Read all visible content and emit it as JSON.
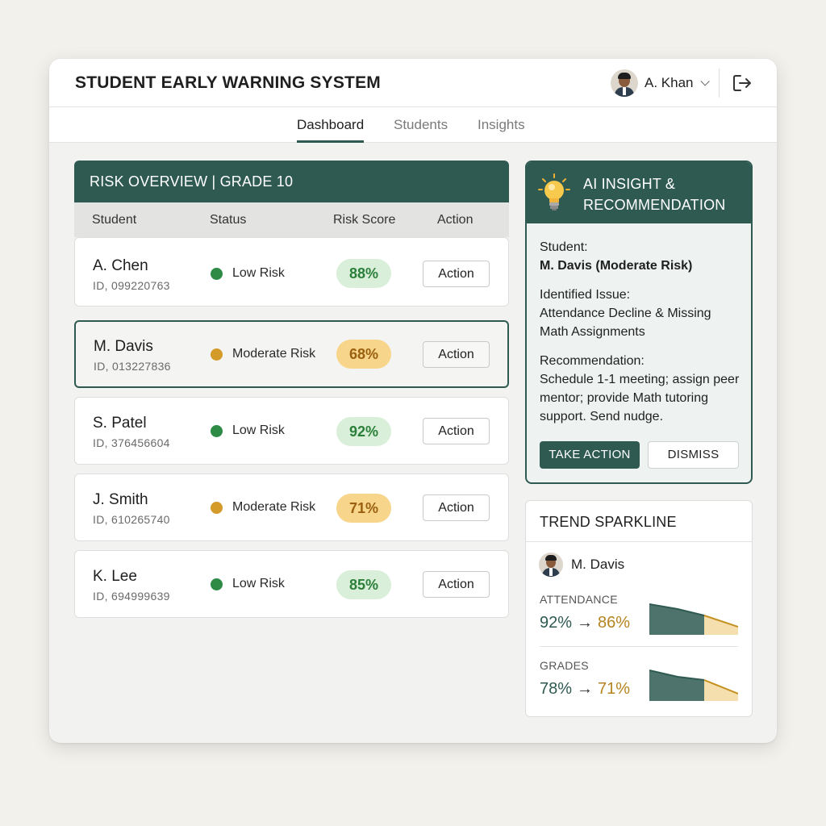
{
  "app": {
    "title": "STUDENT EARLY WARNING SYSTEM",
    "user_name": "A. Khan",
    "icons": {
      "user": "avatar-icon",
      "dropdown": "chevron-down-icon",
      "logout": "logout-icon"
    }
  },
  "tabs": [
    {
      "label": "Dashboard",
      "active": true
    },
    {
      "label": "Students",
      "active": false
    },
    {
      "label": "Insights",
      "active": false
    }
  ],
  "risk_overview": {
    "title": "RISK OVERVIEW | GRADE 10",
    "columns": [
      "Student",
      "Status",
      "Risk Score",
      "Action"
    ],
    "rows": [
      {
        "name": "A. Chen",
        "id": "ID, 099220763",
        "status": "Low Risk",
        "status_color": "#2e8b46",
        "score": "88%",
        "score_tone": "green",
        "action": "Action"
      },
      {
        "name": "M. Davis",
        "id": "ID, 013227836",
        "status": "Moderate Risk",
        "status_color": "#d49a2a",
        "score": "68%",
        "score_tone": "amber",
        "action": "Action",
        "selected": true
      },
      {
        "name": "S. Patel",
        "id": "ID, 376456604",
        "status": "Low Risk",
        "status_color": "#2e8b46",
        "score": "92%",
        "score_tone": "green",
        "action": "Action"
      },
      {
        "name": "J. Smith",
        "id": "ID, 610265740",
        "status": "Moderate Risk",
        "status_color": "#d49a2a",
        "score": "71%",
        "score_tone": "amber",
        "action": "Action"
      },
      {
        "name": "K. Lee",
        "id": "ID, 694999639",
        "status": "Low Risk",
        "status_color": "#2e8b46",
        "score": "85%",
        "score_tone": "green",
        "action": "Action"
      }
    ]
  },
  "ai_insight": {
    "title_line1": "AI INSIGHT &",
    "title_line2": "RECOMMENDATION",
    "icon": "lightbulb-icon",
    "student_label": "Student:",
    "student_value": "M. Davis (Moderate Risk)",
    "issue_label": "Identified Issue:",
    "issue_line1": "Attendance Decline & Missing",
    "issue_line2": "Math Assignments",
    "rec_label": "Recommendation:",
    "rec_line1": "Schedule 1-1 meeting; assign peer",
    "rec_line2": "mentor; provide Math tutoring",
    "rec_line3": "support. Send nudge.",
    "take_action": "TAKE ACTION",
    "dismiss": "DISMISS"
  },
  "trend": {
    "title": "TREND SPARKLINE",
    "student": "M. Davis",
    "metrics": [
      {
        "label": "ATTENDANCE",
        "from": "92%",
        "arrow": "→",
        "to": "86%"
      },
      {
        "label": "GRADES",
        "from": "78%",
        "arrow": "→",
        "to": "71%"
      }
    ]
  },
  "colors": {
    "accent": "#2f5a52",
    "low_risk": "#2e8b46",
    "moderate_risk": "#d49a2a",
    "decline": "#b58420"
  }
}
